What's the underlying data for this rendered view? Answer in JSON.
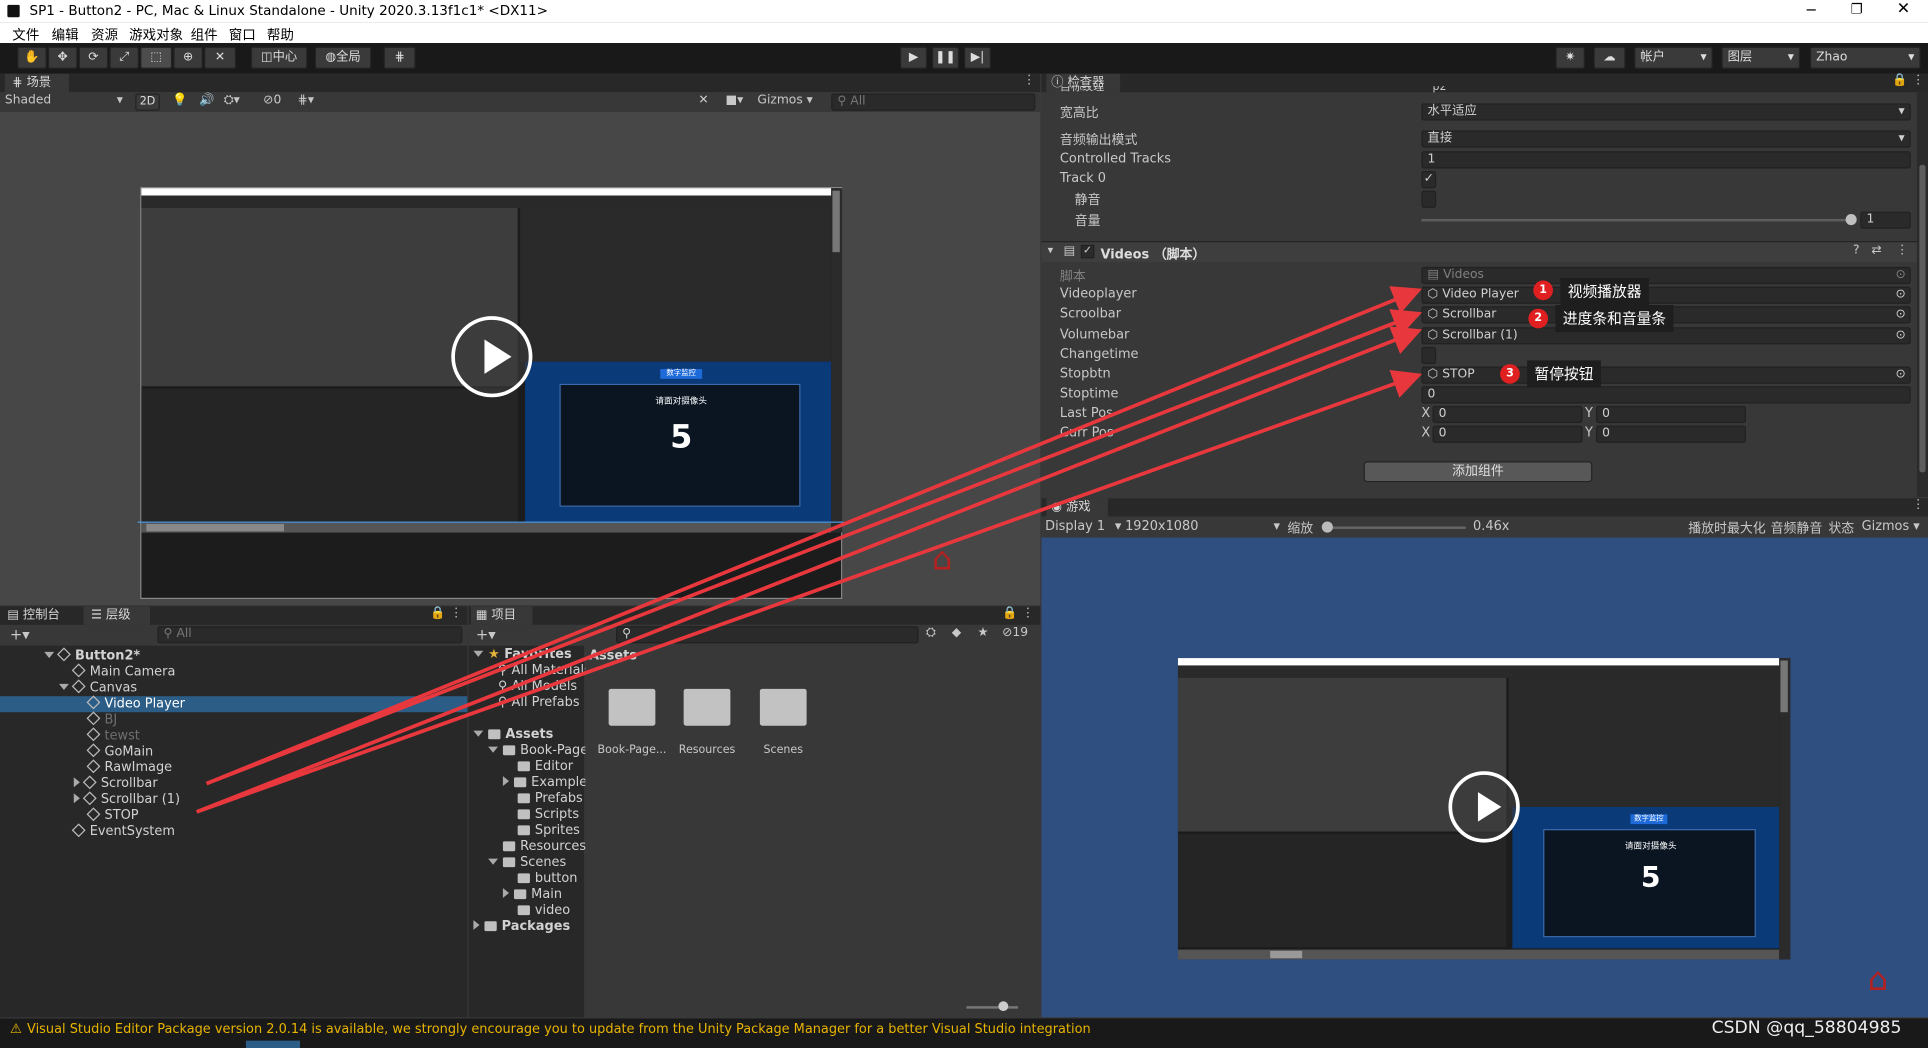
{
  "window": {
    "title": "SP1 - Button2 - PC, Mac & Linux Standalone - Unity 2020.3.13f1c1* <DX11>"
  },
  "menu": [
    "文件",
    "编辑",
    "资源",
    "游戏对象",
    "组件",
    "窗口",
    "帮助"
  ],
  "toolbar": {
    "pivot": "中心",
    "global": "全局",
    "account": "帐户",
    "layers": "图层",
    "user": "Zhao"
  },
  "scene": {
    "tab": "场景",
    "shading": "Shaded",
    "mode2d": "2D",
    "hidden_count": "0",
    "gizmos": "Gizmos",
    "search_placeholder": "All"
  },
  "preview": {
    "title": "请面对摄像头",
    "countdown": "5",
    "header": "数字监控"
  },
  "inspector": {
    "tab": "检查器",
    "cut_label": "目标纹理",
    "cut_value": "p2",
    "rows": [
      {
        "label": "宽高比",
        "value": "水平适应",
        "type": "dropdown"
      },
      {
        "label": "音频输出模式",
        "value": "直接",
        "type": "dropdown"
      },
      {
        "label": "Controlled Tracks",
        "value": "1",
        "type": "field"
      },
      {
        "label": "Track 0",
        "value": "",
        "type": "check"
      },
      {
        "label": "静音",
        "value": "",
        "type": "check-off"
      },
      {
        "label": "音量",
        "value": "1",
        "type": "slider"
      }
    ],
    "component_title": "Videos  （脚本）",
    "script_rows": [
      {
        "label": "脚本",
        "value": "Videos"
      },
      {
        "label": "Videoplayer",
        "value": "Video Player"
      },
      {
        "label": "Scroolbar",
        "value": "Scrollbar"
      },
      {
        "label": "Volumebar",
        "value": "Scrollbar (1)"
      },
      {
        "label": "Changetime",
        "value": ""
      },
      {
        "label": "Stopbtn",
        "value": "STOP"
      },
      {
        "label": "Stoptime",
        "value": "0"
      },
      {
        "label": "Last Pos",
        "value": ""
      },
      {
        "label": "Curr Pos",
        "value": ""
      }
    ],
    "pos_x_label": "X",
    "pos_y_label": "Y",
    "pos_zero": "0",
    "add_component": "添加组件"
  },
  "annotations": [
    {
      "num": "1",
      "text": "视频播放器"
    },
    {
      "num": "2",
      "text": "进度条和音量条"
    },
    {
      "num": "3",
      "text": "暂停按钮"
    }
  ],
  "hierarchy": {
    "tab_console": "控制台",
    "tab_hierarchy": "层级",
    "search_placeholder": "All",
    "items": [
      {
        "label": "Button2*",
        "indent": 0
      },
      {
        "label": "Main Camera",
        "indent": 1
      },
      {
        "label": "Canvas",
        "indent": 1
      },
      {
        "label": "Video Player",
        "indent": 2
      },
      {
        "label": "BJ",
        "indent": 2
      },
      {
        "label": "tewst",
        "indent": 2
      },
      {
        "label": "GoMain",
        "indent": 2
      },
      {
        "label": "RawImage",
        "indent": 2
      },
      {
        "label": "Scrollbar",
        "indent": 2
      },
      {
        "label": "Scrollbar (1)",
        "indent": 2
      },
      {
        "label": "STOP",
        "indent": 2
      },
      {
        "label": "EventSystem",
        "indent": 1
      }
    ]
  },
  "project": {
    "tab": "项目",
    "badge": "19",
    "favorites": "Favorites",
    "fav_items": [
      "All Materials",
      "All Models",
      "All Prefabs"
    ],
    "assets_header": "Assets",
    "tree": [
      {
        "label": "Assets",
        "indent": 0,
        "bold": true
      },
      {
        "label": "Book-Page",
        "indent": 1
      },
      {
        "label": "Editor",
        "indent": 2
      },
      {
        "label": "Examples",
        "indent": 2
      },
      {
        "label": "Prefabs",
        "indent": 2
      },
      {
        "label": "Scripts",
        "indent": 2
      },
      {
        "label": "Sprites",
        "indent": 2
      },
      {
        "label": "Resources",
        "indent": 1
      },
      {
        "label": "Scenes",
        "indent": 1
      },
      {
        "label": "button",
        "indent": 2
      },
      {
        "label": "Main",
        "indent": 2
      },
      {
        "label": "video",
        "indent": 2
      },
      {
        "label": "Packages",
        "indent": 0,
        "bold": true
      }
    ],
    "grid": [
      "Book-Page...",
      "Resources",
      "Scenes"
    ]
  },
  "game": {
    "tab": "游戏",
    "display": "Display 1",
    "resolution": "1920x1080",
    "zoom_label": "缩放",
    "zoom_value": "0.46x",
    "maximize": "播放时最大化",
    "mute": "音频静音",
    "stats": "状态",
    "gizmos": "Gizmos",
    "preview_title": "请面对摄像头",
    "preview_count": "5",
    "preview_header": "数字监控"
  },
  "statusbar": {
    "message": "Visual Studio Editor Package version 2.0.14 is available, we strongly encourage you to update from the Unity Package Manager for a better Visual Studio integration"
  },
  "watermark": "CSDN @qq_58804985",
  "colors": {
    "accent": "#2c5d87",
    "annotation_red": "#e8383d",
    "game_bg": "#2f4f80"
  }
}
